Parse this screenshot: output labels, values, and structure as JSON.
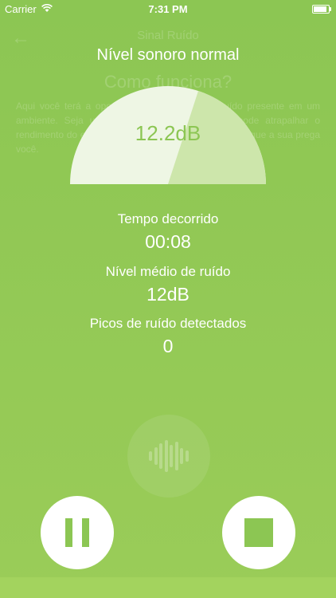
{
  "status_bar": {
    "carrier": "Carrier",
    "time": "7:31 PM"
  },
  "background": {
    "back_arrow": "←",
    "title": "Sinal Ruído",
    "subtitle": "Como funciona?",
    "text": "Aqui você terá a oportunidade de mesurar o ruído presente em um ambiente. Seja um ruído é muito intenso, ele pode atrapalhar o rendimento do esforço que você faz para escutar. Pratique a sua prega você."
  },
  "meter": {
    "heading": "Nível sonoro normal",
    "value": "12.2dB",
    "fraction": 0.4,
    "colors": {
      "light": "#eef6e4",
      "mid": "#cde6ab",
      "value_text": "#8cc653"
    }
  },
  "stats": {
    "elapsed_label": "Tempo decorrido",
    "elapsed_value": "00:08",
    "avg_label": "Nível médio de ruído",
    "avg_value": "12dB",
    "peaks_label": "Picos de ruído detectados",
    "peaks_value": "0"
  },
  "controls": {
    "pause_icon": "pause-icon",
    "stop_icon": "stop-icon",
    "accent": "#8cc653"
  }
}
